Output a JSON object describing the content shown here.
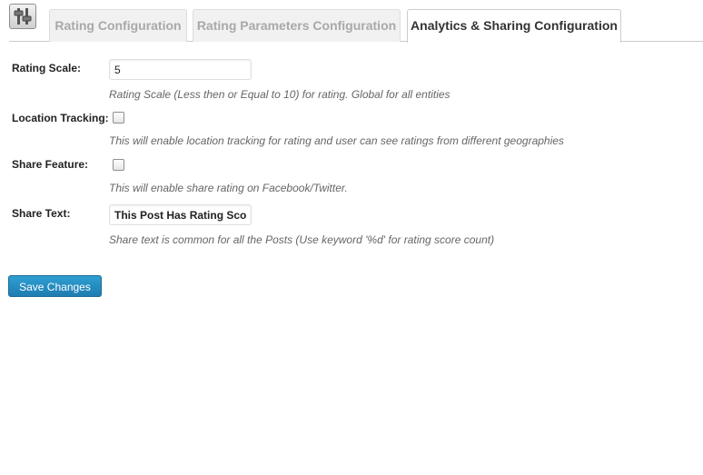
{
  "icon": {
    "name": "settings-sliders-icon"
  },
  "tabs": [
    {
      "label": "Rating Configuration",
      "active": false
    },
    {
      "label": "Rating Parameters Configuration",
      "active": false
    },
    {
      "label": "Analytics & Sharing Configuration",
      "active": true
    }
  ],
  "form": {
    "rating_scale": {
      "label": "Rating Scale:",
      "value": "5",
      "description": "Rating Scale (Less then or Equal to 10) for rating. Global for all entities"
    },
    "location_tracking": {
      "label": "Location Tracking:",
      "checked": false,
      "description": "This will enable location tracking for rating and user can see ratings from different geographies"
    },
    "share_feature": {
      "label": "Share Feature:",
      "checked": false,
      "description": "This will enable share rating on Facebook/Twitter."
    },
    "share_text": {
      "label": "Share Text:",
      "value": "This Post Has Rating Scor",
      "description": "Share text is common for all the Posts (Use keyword '%d' for rating score count)"
    }
  },
  "save_button": {
    "label": "Save Changes"
  },
  "colors": {
    "button_blue": "#2289bf",
    "tab_border": "#cccccc",
    "inactive_tab_text": "#a9a9a9"
  }
}
